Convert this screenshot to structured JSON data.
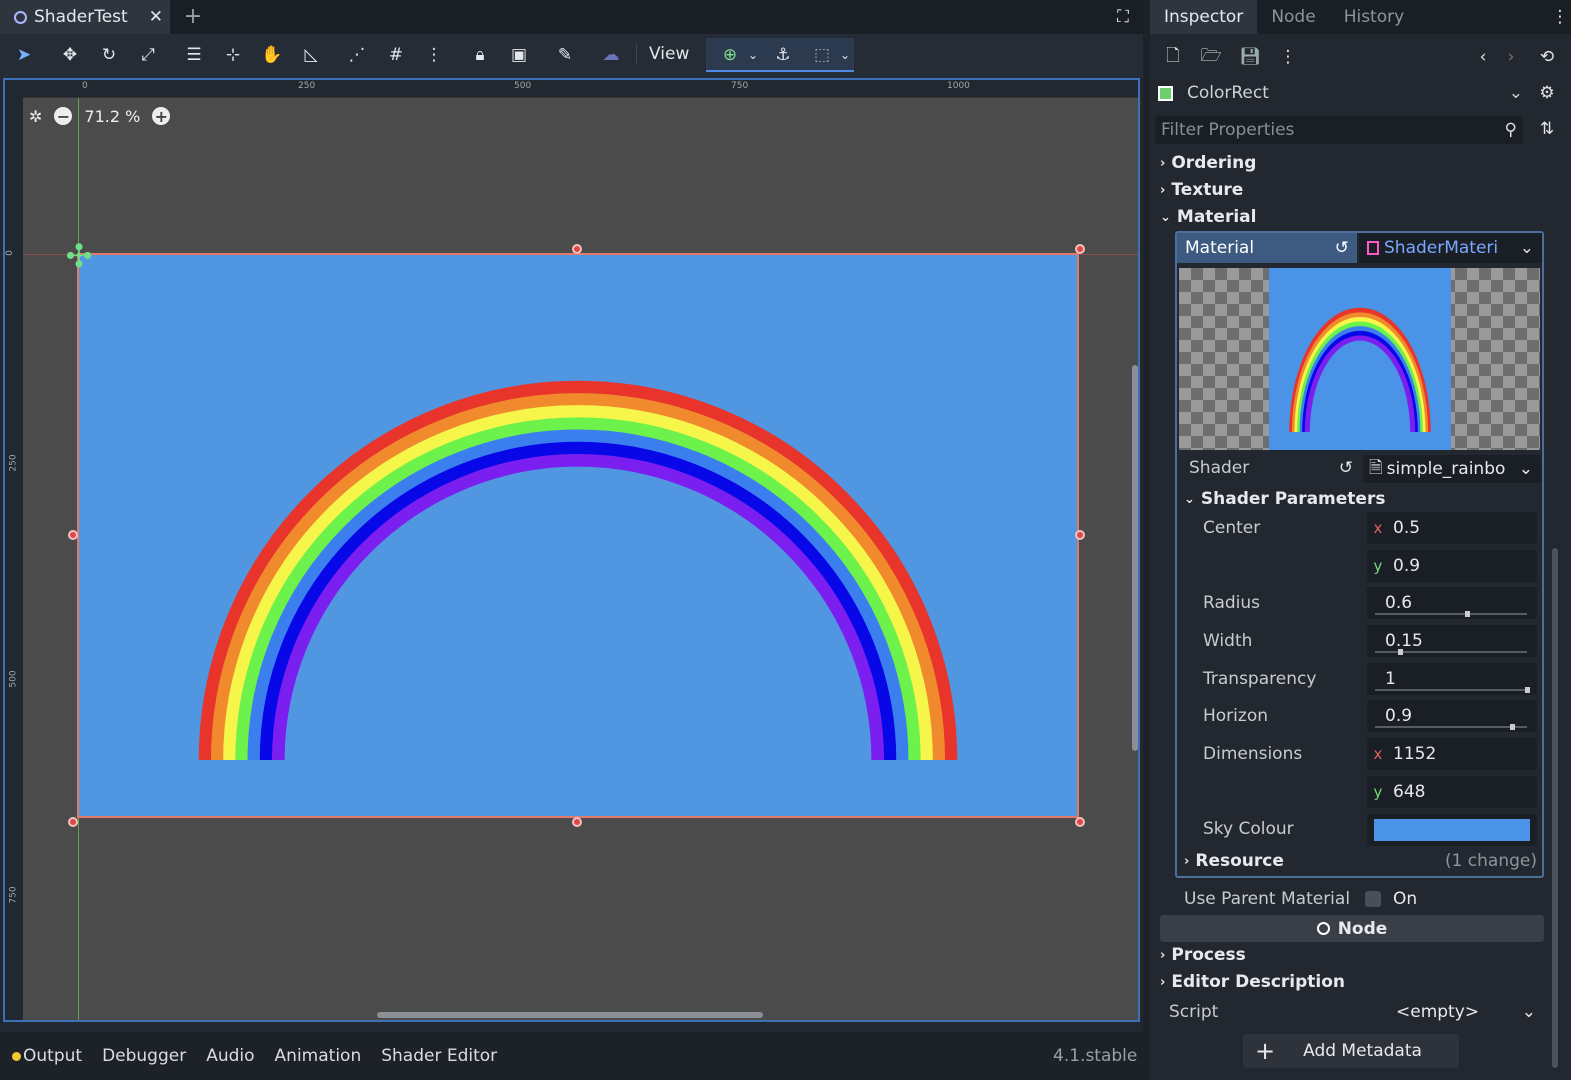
{
  "scene_tab": {
    "title": "ShaderTest",
    "close": "✕",
    "add": "+"
  },
  "toolbar": {
    "view_label": "View"
  },
  "viewport": {
    "zoom": "71.2 %",
    "ruler_top": [
      "0",
      "250",
      "500",
      "750",
      "1000"
    ],
    "ruler_left": [
      "0",
      "250",
      "500",
      "750"
    ]
  },
  "rect_color": "#5196e0",
  "bottom": {
    "tabs": [
      "Output",
      "Debugger",
      "Audio",
      "Animation",
      "Shader Editor"
    ],
    "version": "4.1.stable"
  },
  "inspector": {
    "tabs": [
      "Inspector",
      "Node",
      "History"
    ],
    "node_type": "ColorRect",
    "filter_placeholder": "Filter Properties",
    "groups": {
      "ordering": "Ordering",
      "texture": "Texture",
      "material": "Material"
    },
    "material_label": "Material",
    "material_value": "ShaderMateri",
    "shader_label": "Shader",
    "shader_value": "simple_rainbo",
    "shader_params_label": "Shader Parameters",
    "params": {
      "center": {
        "label": "Center",
        "x": "0.5",
        "y": "0.9"
      },
      "radius": {
        "label": "Radius",
        "value": "0.6",
        "fraction": 0.6
      },
      "width": {
        "label": "Width",
        "value": "0.15",
        "fraction": 0.15
      },
      "transparency": {
        "label": "Transparency",
        "value": "1",
        "fraction": 1
      },
      "horizon": {
        "label": "Horizon",
        "value": "0.9",
        "fraction": 0.9
      },
      "dimensions": {
        "label": "Dimensions",
        "x": "1152",
        "y": "648"
      },
      "sky": {
        "label": "Sky Colour",
        "color": "#4a93e6"
      }
    },
    "resource_label": "Resource",
    "resource_changes": "(1 change)",
    "use_parent_label": "Use Parent Material",
    "use_parent_value": "On",
    "node_section": "Node",
    "process": "Process",
    "editor_description": "Editor Description",
    "script_label": "Script",
    "script_value": "<empty>",
    "add_metadata": "Add Metadata"
  },
  "rainbow_colors": [
    "#e8342a",
    "#f08a2c",
    "#f5f54a",
    "#6cf24a",
    "#3b7fee",
    "#0707e8",
    "#7a1ff0"
  ]
}
